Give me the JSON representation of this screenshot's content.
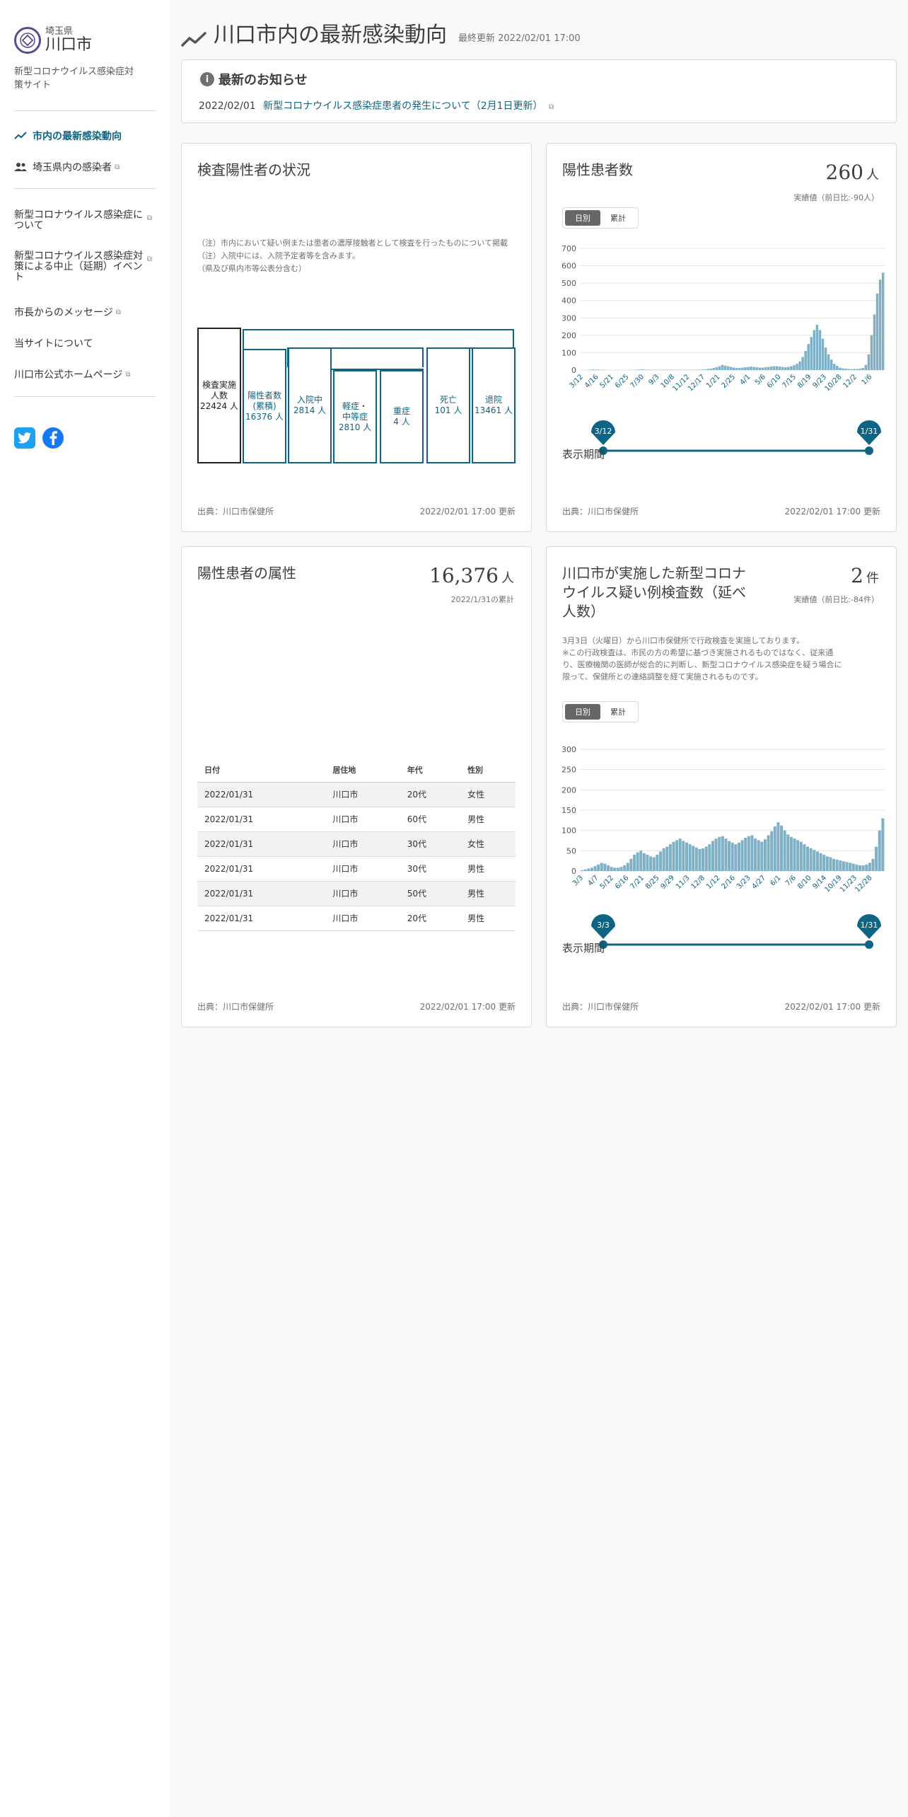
{
  "sidebar": {
    "pref": "埼玉県",
    "city": "川口市",
    "subtitle": "新型コロナウイルス感染症対策サイト",
    "items": [
      {
        "label": "市内の最新感染動向"
      },
      {
        "label": "埼玉県内の感染者"
      },
      {
        "label": "新型コロナウイルス感染症について"
      },
      {
        "label": "新型コロナウイルス感染症対策による中止（延期）イベント"
      },
      {
        "label": "市長からのメッセージ"
      },
      {
        "label": "当サイトについて"
      },
      {
        "label": "川口市公式ホームページ"
      }
    ],
    "social": [
      "twitter-icon",
      "facebook-icon"
    ],
    "colors": {
      "accent": "#0e6483",
      "twitter": "#1da1f2",
      "facebook": "#1877f2"
    }
  },
  "header": {
    "title": "川口市内の最新感染動向",
    "updated": "最終更新 2022/02/01 17:00"
  },
  "news": {
    "title": "最新のお知らせ",
    "date": "2022/02/01",
    "link": "新型コロナウイルス感染症患者の発生について（2月1日更新）"
  },
  "cards": {
    "status": {
      "title": "検査陽性者の状況",
      "notes": [
        "（注）市内において疑い例または患者の濃厚接触者として検査を行ったものについて掲載",
        "（注）入院中には、入院予定者等を含みます。",
        "（県及び県内市等公表分含む）"
      ],
      "boxes": [
        {
          "label": "検査実施人数",
          "value": "22424 人"
        },
        {
          "label": "陽性者数(累積)",
          "value": "16376 人"
        },
        {
          "label": "入院中",
          "value": "2814 人"
        },
        {
          "label": "軽症・中等症",
          "value": "2810 人"
        },
        {
          "label": "重症",
          "value": "4 人"
        },
        {
          "label": "死亡",
          "value": "101 人"
        },
        {
          "label": "退院",
          "value": "13461 人"
        }
      ],
      "source": "出典：川口市保健所",
      "updated": "2022/02/01 17:00 更新"
    },
    "patients": {
      "title": "陽性患者数",
      "value": "260",
      "unit": "人",
      "diff": "実績値（前日比:-90人）",
      "toggle": [
        "日別",
        "累計"
      ],
      "range_label": "表示期間",
      "range_start": "3/12",
      "range_end": "1/31",
      "source": "出典：川口市保健所",
      "updated": "2022/02/01 17:00 更新"
    },
    "attributes": {
      "title": "陽性患者の属性",
      "value": "16,376",
      "unit": "人",
      "sub": "2022/1/31の累計",
      "columns": [
        "日付",
        "居住地",
        "年代",
        "性別"
      ],
      "rows": [
        [
          "2022/01/31",
          "川口市",
          "20代",
          "女性"
        ],
        [
          "2022/01/31",
          "川口市",
          "60代",
          "男性"
        ],
        [
          "2022/01/31",
          "川口市",
          "30代",
          "女性"
        ],
        [
          "2022/01/31",
          "川口市",
          "30代",
          "男性"
        ],
        [
          "2022/01/31",
          "川口市",
          "50代",
          "男性"
        ],
        [
          "2022/01/31",
          "川口市",
          "20代",
          "男性"
        ]
      ],
      "source": "出典：川口市保健所",
      "updated": "2022/02/01 17:00 更新"
    },
    "tests": {
      "title": "川口市が実施した新型コロナウイルス疑い例検査数（延べ人数）",
      "value": "2",
      "unit": "件",
      "diff": "実績値（前日比:-84件）",
      "notes": [
        "3月3日（火曜日）から川口市保健所で行政検査を実施しております。",
        "※この行政検査は、市民の方の希望に基づき実施されるものではなく、従来通り、医療機関の医師が総合的に判断し、新型コロナウイルス感染症を疑う場合に限って、保健所との連絡調整を経て実施されるものです。"
      ],
      "toggle": [
        "日別",
        "累計"
      ],
      "range_label": "表示期間",
      "range_start": "3/3",
      "range_end": "1/31",
      "source": "出典：川口市保健所",
      "updated": "2022/02/01 17:00 更新"
    }
  },
  "chart_data": [
    {
      "type": "bar",
      "title": "陽性患者数",
      "ylim": [
        0,
        700
      ],
      "yticks": [
        0,
        100,
        200,
        300,
        400,
        500,
        600,
        700
      ],
      "xticks": [
        "3/12",
        "4/16",
        "5/21",
        "6/25",
        "7/30",
        "9/3",
        "10/8",
        "11/12",
        "12/17",
        "1/21",
        "2/25",
        "4/1",
        "5/6",
        "6/10",
        "7/15",
        "8/19",
        "9/23",
        "10/28",
        "12/2",
        "1/6"
      ],
      "color": "#7fb0c5",
      "x_start": "2020/3/12",
      "x_end": "2022/1/31",
      "values": [
        0,
        0,
        1,
        2,
        3,
        3,
        2,
        1,
        1,
        0,
        0,
        0,
        0,
        0,
        0,
        0,
        0,
        1,
        1,
        2,
        3,
        4,
        3,
        2,
        2,
        1,
        1,
        1,
        1,
        2,
        2,
        2,
        2,
        1,
        1,
        1,
        1,
        1,
        1,
        1,
        2,
        2,
        3,
        4,
        6,
        8,
        12,
        16,
        22,
        30,
        26,
        22,
        18,
        14,
        12,
        12,
        14,
        16,
        18,
        20,
        18,
        16,
        14,
        14,
        16,
        18,
        20,
        22,
        22,
        20,
        18,
        16,
        18,
        22,
        28,
        36,
        50,
        75,
        110,
        150,
        190,
        230,
        260,
        230,
        180,
        130,
        90,
        60,
        36,
        24,
        14,
        10,
        8,
        6,
        5,
        6,
        6,
        8,
        12,
        30,
        90,
        200,
        320,
        440,
        520,
        560
      ]
    },
    {
      "type": "bar",
      "title": "川口市が実施した新型コロナウイルス疑い例検査数（延べ人数）",
      "ylim": [
        0,
        300
      ],
      "yticks": [
        0,
        50,
        100,
        150,
        200,
        250,
        300
      ],
      "xticks": [
        "3/3",
        "4/7",
        "5/12",
        "6/16",
        "7/21",
        "8/25",
        "9/29",
        "11/3",
        "12/8",
        "1/12",
        "2/16",
        "3/23",
        "4/27",
        "6/1",
        "7/6",
        "8/10",
        "9/14",
        "10/19",
        "11/23",
        "12/28"
      ],
      "color": "#7fb0c5",
      "x_start": "2020/3/3",
      "x_end": "2022/1/31",
      "values": [
        2,
        4,
        6,
        8,
        12,
        16,
        20,
        18,
        14,
        10,
        8,
        8,
        10,
        14,
        20,
        30,
        40,
        46,
        50,
        44,
        40,
        36,
        34,
        40,
        48,
        56,
        60,
        66,
        72,
        76,
        80,
        74,
        70,
        66,
        62,
        58,
        54,
        56,
        60,
        66,
        74,
        80,
        84,
        86,
        80,
        74,
        70,
        66,
        70,
        76,
        82,
        86,
        88,
        80,
        76,
        72,
        78,
        88,
        98,
        110,
        120,
        112,
        100,
        90,
        84,
        80,
        76,
        72,
        66,
        60,
        56,
        52,
        48,
        44,
        40,
        36,
        34,
        30,
        28,
        26,
        24,
        22,
        20,
        18,
        16,
        14,
        14,
        16,
        20,
        30,
        60,
        100,
        130
      ]
    }
  ]
}
